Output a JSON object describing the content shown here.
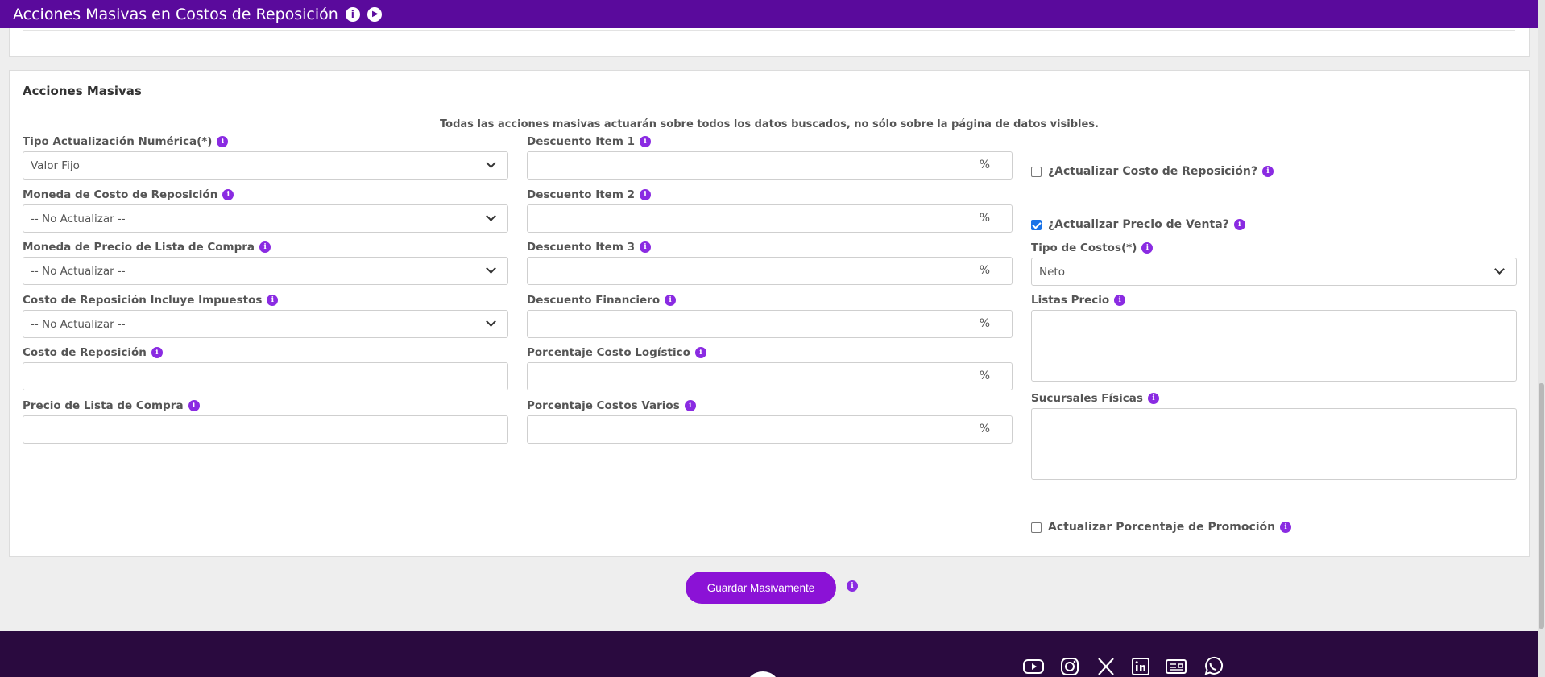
{
  "header": {
    "title": "Acciones Masivas en Costos de Reposición",
    "info_icon": "info-icon",
    "play_icon": "play-icon"
  },
  "panel": {
    "title": "Acciones Masivas",
    "notice": "Todas las acciones masivas actuarán sobre todos los datos buscados, no sólo sobre la página de datos visibles."
  },
  "left": {
    "tipo_actualizacion": {
      "label": "Tipo Actualización Numérica(*)",
      "value": "Valor Fijo"
    },
    "moneda_costo": {
      "label": "Moneda de Costo de Reposición",
      "value": "-- No Actualizar --"
    },
    "moneda_precio_lista": {
      "label": "Moneda de Precio de Lista de Compra",
      "value": "-- No Actualizar --"
    },
    "costo_incluye_impuestos": {
      "label": "Costo de Reposición Incluye Impuestos",
      "value": "-- No Actualizar --"
    },
    "costo_reposicion": {
      "label": "Costo de Reposición",
      "value": ""
    },
    "precio_lista_compra": {
      "label": "Precio de Lista de Compra",
      "value": ""
    }
  },
  "middle": {
    "unit": "%",
    "descuento_1": {
      "label": "Descuento Item 1",
      "value": ""
    },
    "descuento_2": {
      "label": "Descuento Item 2",
      "value": ""
    },
    "descuento_3": {
      "label": "Descuento Item 3",
      "value": ""
    },
    "descuento_financiero": {
      "label": "Descuento Financiero",
      "value": ""
    },
    "porcentaje_logistico": {
      "label": "Porcentaje Costo Logístico",
      "value": ""
    },
    "porcentaje_varios": {
      "label": "Porcentaje Costos Varios",
      "value": ""
    }
  },
  "right": {
    "actualizar_costo": {
      "label": "¿Actualizar Costo de Reposición?",
      "checked": false
    },
    "actualizar_precio": {
      "label": "¿Actualizar Precio de Venta?",
      "checked": true
    },
    "tipo_costos": {
      "label": "Tipo de Costos(*)",
      "value": "Neto"
    },
    "listas_precio": {
      "label": "Listas Precio"
    },
    "sucursales": {
      "label": "Sucursales Físicas"
    },
    "actualizar_promocion": {
      "label": "Actualizar Porcentaje de Promoción",
      "checked": false
    }
  },
  "actions": {
    "save_label": "Guardar Masivamente"
  },
  "footer": {
    "social_icons": [
      "youtube-icon",
      "instagram-icon",
      "x-icon",
      "linkedin-icon",
      "news-icon",
      "whatsapp-icon"
    ]
  },
  "colors": {
    "header_bg": "#5a0a9c",
    "accent": "#8b12d6",
    "info": "#8a2be2",
    "footer_bg": "#2a0a3f"
  }
}
